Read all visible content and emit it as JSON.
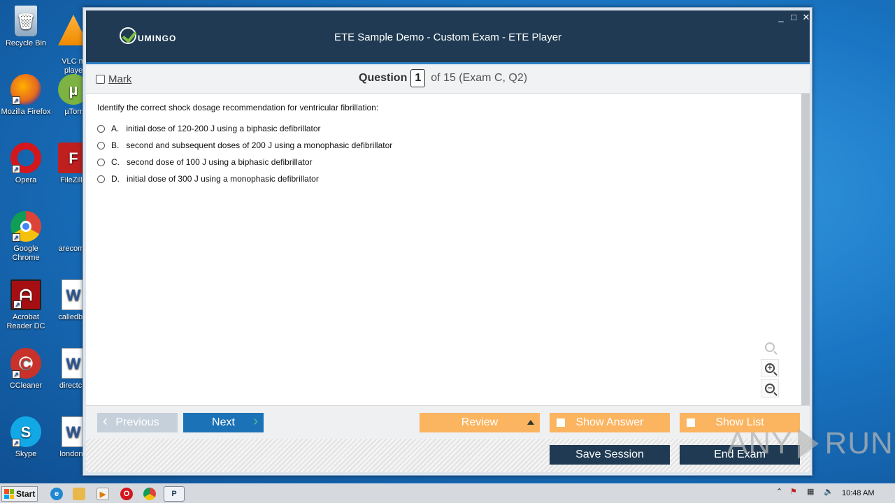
{
  "desktop": {
    "icons": [
      {
        "label": "Recycle Bin",
        "icon": "recycle-bin-icon",
        "color": "#6a8fb5"
      },
      {
        "label": "Mozilla Firefox",
        "icon": "firefox-icon",
        "color": "#e66a1e"
      },
      {
        "label": "Opera",
        "icon": "opera-icon",
        "color": "#d4161d"
      },
      {
        "label": "Google Chrome",
        "icon": "chrome-icon",
        "color": "#3c9a4a"
      },
      {
        "label": "Acrobat Reader DC",
        "icon": "acrobat-icon",
        "color": "#a50f12"
      },
      {
        "label": "CCleaner",
        "icon": "ccleaner-icon",
        "color": "#c8322b"
      },
      {
        "label": "Skype",
        "icon": "skype-icon",
        "color": "#12a8e6"
      },
      {
        "label": "VLC m\nplaye",
        "icon": "vlc-icon",
        "color": "#f08a00"
      },
      {
        "label": "µTorr",
        "icon": "utorrent-icon",
        "color": "#7cb342"
      },
      {
        "label": "FileZilla",
        "icon": "filezilla-icon",
        "color": "#bf1f1f"
      },
      {
        "label": "arecome",
        "icon": "file-icon",
        "color": "#1a76c4"
      },
      {
        "label": "calledbla",
        "icon": "word-doc-icon",
        "color": "#2b5797"
      },
      {
        "label": "directciti",
        "icon": "word-doc-icon",
        "color": "#2b5797"
      },
      {
        "label": "londong",
        "icon": "word-doc-icon",
        "color": "#2b5797"
      }
    ]
  },
  "window": {
    "title": "ETE Sample Demo - Custom Exam - ETE Player",
    "logo_text": "UMINGO",
    "controls": {
      "minimize": "_",
      "maximize": "□",
      "close": "✕"
    }
  },
  "question_header": {
    "mark_label": "Mark",
    "question_label": "Question",
    "question_number": "1",
    "of_text": "of 15 (Exam C, Q2)"
  },
  "question": {
    "text": "Identify the correct shock dosage recommendation for ventricular fibrillation:",
    "options": [
      {
        "key": "A.",
        "text": "initial dose of 120-200 J using a biphasic defibrillator"
      },
      {
        "key": "B.",
        "text": "second and subsequent doses of 200 J using a monophasic defibrillator"
      },
      {
        "key": "C.",
        "text": "second dose of 100 J using a biphasic defibrillator"
      },
      {
        "key": "D.",
        "text": "initial dose of 300 J using a monophasic defibrillator"
      }
    ]
  },
  "zoom": {
    "zoom_in": "+",
    "zoom_out": "−"
  },
  "nav": {
    "previous": "Previous",
    "next": "Next",
    "review": "Review",
    "show_answer": "Show Answer",
    "show_list": "Show List"
  },
  "footer": {
    "save_session": "Save Session",
    "end_exam": "End Exam"
  },
  "taskbar": {
    "start_label": "Start",
    "clock": "10:48 AM"
  },
  "watermark": {
    "left": "ANY",
    "right": "RUN"
  },
  "colors": {
    "titlebar": "#1f3a52",
    "accent_blue": "#1c72b6",
    "orange": "#fbb460",
    "dark_button": "#1f3a52"
  }
}
